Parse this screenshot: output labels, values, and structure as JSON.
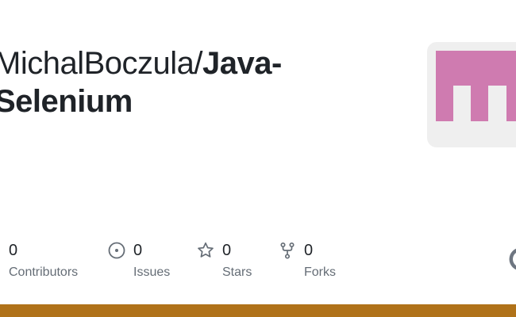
{
  "repo": {
    "owner": "MichalBoczula",
    "separator": "/",
    "name": "Java-Selenium"
  },
  "stats": {
    "contributors": {
      "count": "0",
      "label": "Contributors",
      "icon": "people-icon"
    },
    "issues": {
      "count": "0",
      "label": "Issues",
      "icon": "issue-opened-icon"
    },
    "stars": {
      "count": "0",
      "label": "Stars",
      "icon": "star-icon"
    },
    "forks": {
      "count": "0",
      "label": "Forks",
      "icon": "repo-forked-icon"
    }
  },
  "avatar": {
    "icon": "identicon",
    "color": "#cf7bb0",
    "background": "#efefef"
  },
  "language_bar": {
    "color": "#b07219"
  },
  "colors": {
    "text": "#1f2328",
    "muted": "#656d76",
    "icon": "#656d76"
  }
}
